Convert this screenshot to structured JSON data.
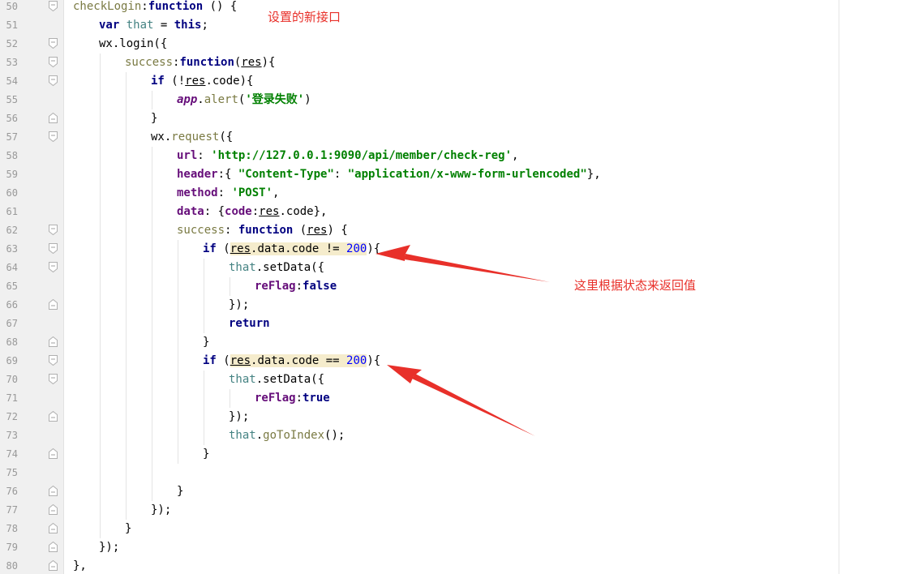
{
  "editor": {
    "lines": [
      {
        "n": "50",
        "t": [
          {
            "s": "checkLogin",
            "c": "fn"
          },
          {
            "s": ":"
          },
          {
            "s": "function",
            "c": "kw"
          },
          {
            "s": " () {"
          }
        ]
      },
      {
        "n": "51",
        "t": [
          {
            "s": "var",
            "c": "kw"
          },
          {
            "s": " "
          },
          {
            "s": "that",
            "c": "thatv"
          },
          {
            "s": " = "
          },
          {
            "s": "this",
            "c": "kw"
          },
          {
            "s": ";"
          }
        ]
      },
      {
        "n": "52",
        "t": [
          {
            "s": "wx.login({"
          }
        ]
      },
      {
        "n": "53",
        "t": [
          {
            "s": "success",
            "c": "fn"
          },
          {
            "s": ":"
          },
          {
            "s": "function",
            "c": "kw"
          },
          {
            "s": "("
          },
          {
            "s": "res",
            "c": "param"
          },
          {
            "s": "){"
          }
        ]
      },
      {
        "n": "54",
        "t": [
          {
            "s": "if",
            "c": "kw"
          },
          {
            "s": " (!"
          },
          {
            "s": "res",
            "c": "param"
          },
          {
            "s": ".code){"
          }
        ]
      },
      {
        "n": "55",
        "t": [
          {
            "s": "app",
            "c": "glob"
          },
          {
            "s": "."
          },
          {
            "s": "alert",
            "c": "fn"
          },
          {
            "s": "("
          },
          {
            "s": "'登录失败'",
            "c": "str"
          },
          {
            "s": ")"
          }
        ]
      },
      {
        "n": "56",
        "t": [
          {
            "s": "}"
          }
        ]
      },
      {
        "n": "57",
        "t": [
          {
            "s": "wx."
          },
          {
            "s": "request",
            "c": "fn"
          },
          {
            "s": "({"
          }
        ]
      },
      {
        "n": "58",
        "t": [
          {
            "s": "url",
            "c": "prop"
          },
          {
            "s": ": "
          },
          {
            "s": "'http://127.0.0.1:9090/api/member/check-reg'",
            "c": "str"
          },
          {
            "s": ","
          }
        ]
      },
      {
        "n": "59",
        "t": [
          {
            "s": "header",
            "c": "prop"
          },
          {
            "s": ":{ "
          },
          {
            "s": "\"Content-Type\"",
            "c": "str"
          },
          {
            "s": ": "
          },
          {
            "s": "\"application/x-www-form-urlencoded\"",
            "c": "str"
          },
          {
            "s": "},"
          }
        ]
      },
      {
        "n": "60",
        "t": [
          {
            "s": "method",
            "c": "prop"
          },
          {
            "s": ": "
          },
          {
            "s": "'POST'",
            "c": "str"
          },
          {
            "s": ","
          }
        ]
      },
      {
        "n": "61",
        "t": [
          {
            "s": "data",
            "c": "prop"
          },
          {
            "s": ": {"
          },
          {
            "s": "code",
            "c": "prop"
          },
          {
            "s": ":"
          },
          {
            "s": "res",
            "c": "param"
          },
          {
            "s": ".code},"
          }
        ]
      },
      {
        "n": "62",
        "t": [
          {
            "s": "success",
            "c": "fn"
          },
          {
            "s": ": "
          },
          {
            "s": "function",
            "c": "kw"
          },
          {
            "s": " ("
          },
          {
            "s": "res",
            "c": "param"
          },
          {
            "s": ") {"
          }
        ]
      },
      {
        "n": "63",
        "t": [
          {
            "s": "if",
            "c": "kw"
          },
          {
            "s": " ("
          },
          {
            "s": "res",
            "c": "param hl"
          },
          {
            "s": ".data.code != ",
            "c": "hl"
          },
          {
            "s": "200",
            "c": "num hl"
          },
          {
            "s": "){"
          }
        ]
      },
      {
        "n": "64",
        "t": [
          {
            "s": "that",
            "c": "thatv"
          },
          {
            "s": ".setData({"
          }
        ]
      },
      {
        "n": "65",
        "t": [
          {
            "s": "reFlag",
            "c": "prop"
          },
          {
            "s": ":"
          },
          {
            "s": "false",
            "c": "kw"
          }
        ]
      },
      {
        "n": "66",
        "t": [
          {
            "s": "});"
          }
        ]
      },
      {
        "n": "67",
        "t": [
          {
            "s": "return",
            "c": "kw"
          }
        ]
      },
      {
        "n": "68",
        "t": [
          {
            "s": "}"
          }
        ]
      },
      {
        "n": "69",
        "t": [
          {
            "s": "if",
            "c": "kw"
          },
          {
            "s": " ("
          },
          {
            "s": "res",
            "c": "param hl"
          },
          {
            "s": ".data.code == ",
            "c": "hl"
          },
          {
            "s": "200",
            "c": "num hl"
          },
          {
            "s": "){"
          }
        ]
      },
      {
        "n": "70",
        "t": [
          {
            "s": "that",
            "c": "thatv"
          },
          {
            "s": ".setData({"
          }
        ]
      },
      {
        "n": "71",
        "t": [
          {
            "s": "reFlag",
            "c": "prop"
          },
          {
            "s": ":"
          },
          {
            "s": "true",
            "c": "kw"
          }
        ]
      },
      {
        "n": "72",
        "t": [
          {
            "s": "});"
          }
        ]
      },
      {
        "n": "73",
        "t": [
          {
            "s": "that",
            "c": "thatv"
          },
          {
            "s": "."
          },
          {
            "s": "goToIndex",
            "c": "fn"
          },
          {
            "s": "();"
          }
        ]
      },
      {
        "n": "74",
        "t": [
          {
            "s": "}"
          }
        ]
      },
      {
        "n": "75",
        "t": []
      },
      {
        "n": "76",
        "t": [
          {
            "s": "}"
          }
        ]
      },
      {
        "n": "77",
        "t": [
          {
            "s": "});"
          }
        ]
      },
      {
        "n": "78",
        "t": [
          {
            "s": "}"
          }
        ]
      },
      {
        "n": "79",
        "t": [
          {
            "s": "});"
          }
        ]
      },
      {
        "n": "80",
        "t": [
          {
            "s": "},"
          }
        ]
      }
    ]
  },
  "annotations": {
    "interface_note": "设置的新接口",
    "status_note": "这里根据状态来返回值"
  },
  "colors": {
    "annotation": "#e8302a",
    "keyword": "#000080",
    "string": "#008000",
    "number": "#0000ff",
    "highlight": "#f5eccc"
  }
}
